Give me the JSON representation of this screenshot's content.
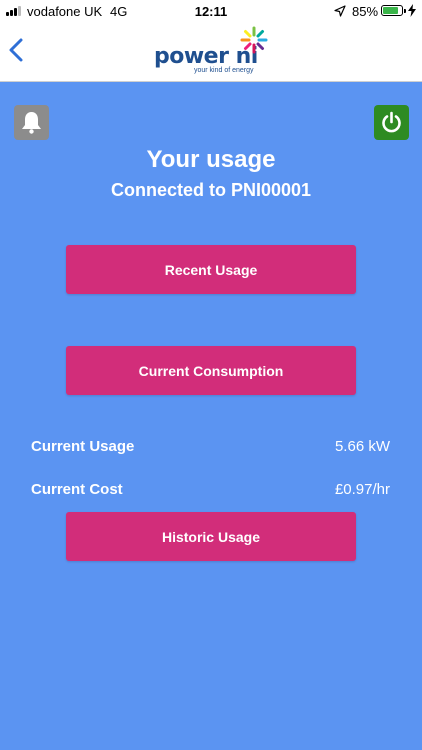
{
  "status_bar": {
    "carrier": "vodafone UK",
    "network": "4G",
    "time": "12:11",
    "battery_percent": "85%",
    "battery_color": "#3ab54a",
    "icons": [
      "signal-icon",
      "location-arrow-icon",
      "battery-icon",
      "charging-bolt-icon"
    ]
  },
  "nav": {
    "back_icon": "chevron-left-icon",
    "logo_word": "power ni",
    "logo_tagline": "your kind of energy"
  },
  "header": {
    "title": "Your usage",
    "subtitle": "Connected to PNI00001",
    "left_icon": "bell-icon",
    "right_icon": "power-icon"
  },
  "buttons": {
    "recent_usage": "Recent Usage",
    "current_consumption": "Current Consumption",
    "historic_usage": "Historic Usage"
  },
  "readings": [
    {
      "label": "Current Usage",
      "value": "5.66 kW"
    },
    {
      "label": "Current Cost",
      "value": "£0.97/hr"
    }
  ],
  "colors": {
    "background": "#5b94f2",
    "button": "#d22d7a",
    "power_button": "#2e8b22",
    "bell_button": "#8c8c8c",
    "brand_blue": "#1f4f8f"
  }
}
